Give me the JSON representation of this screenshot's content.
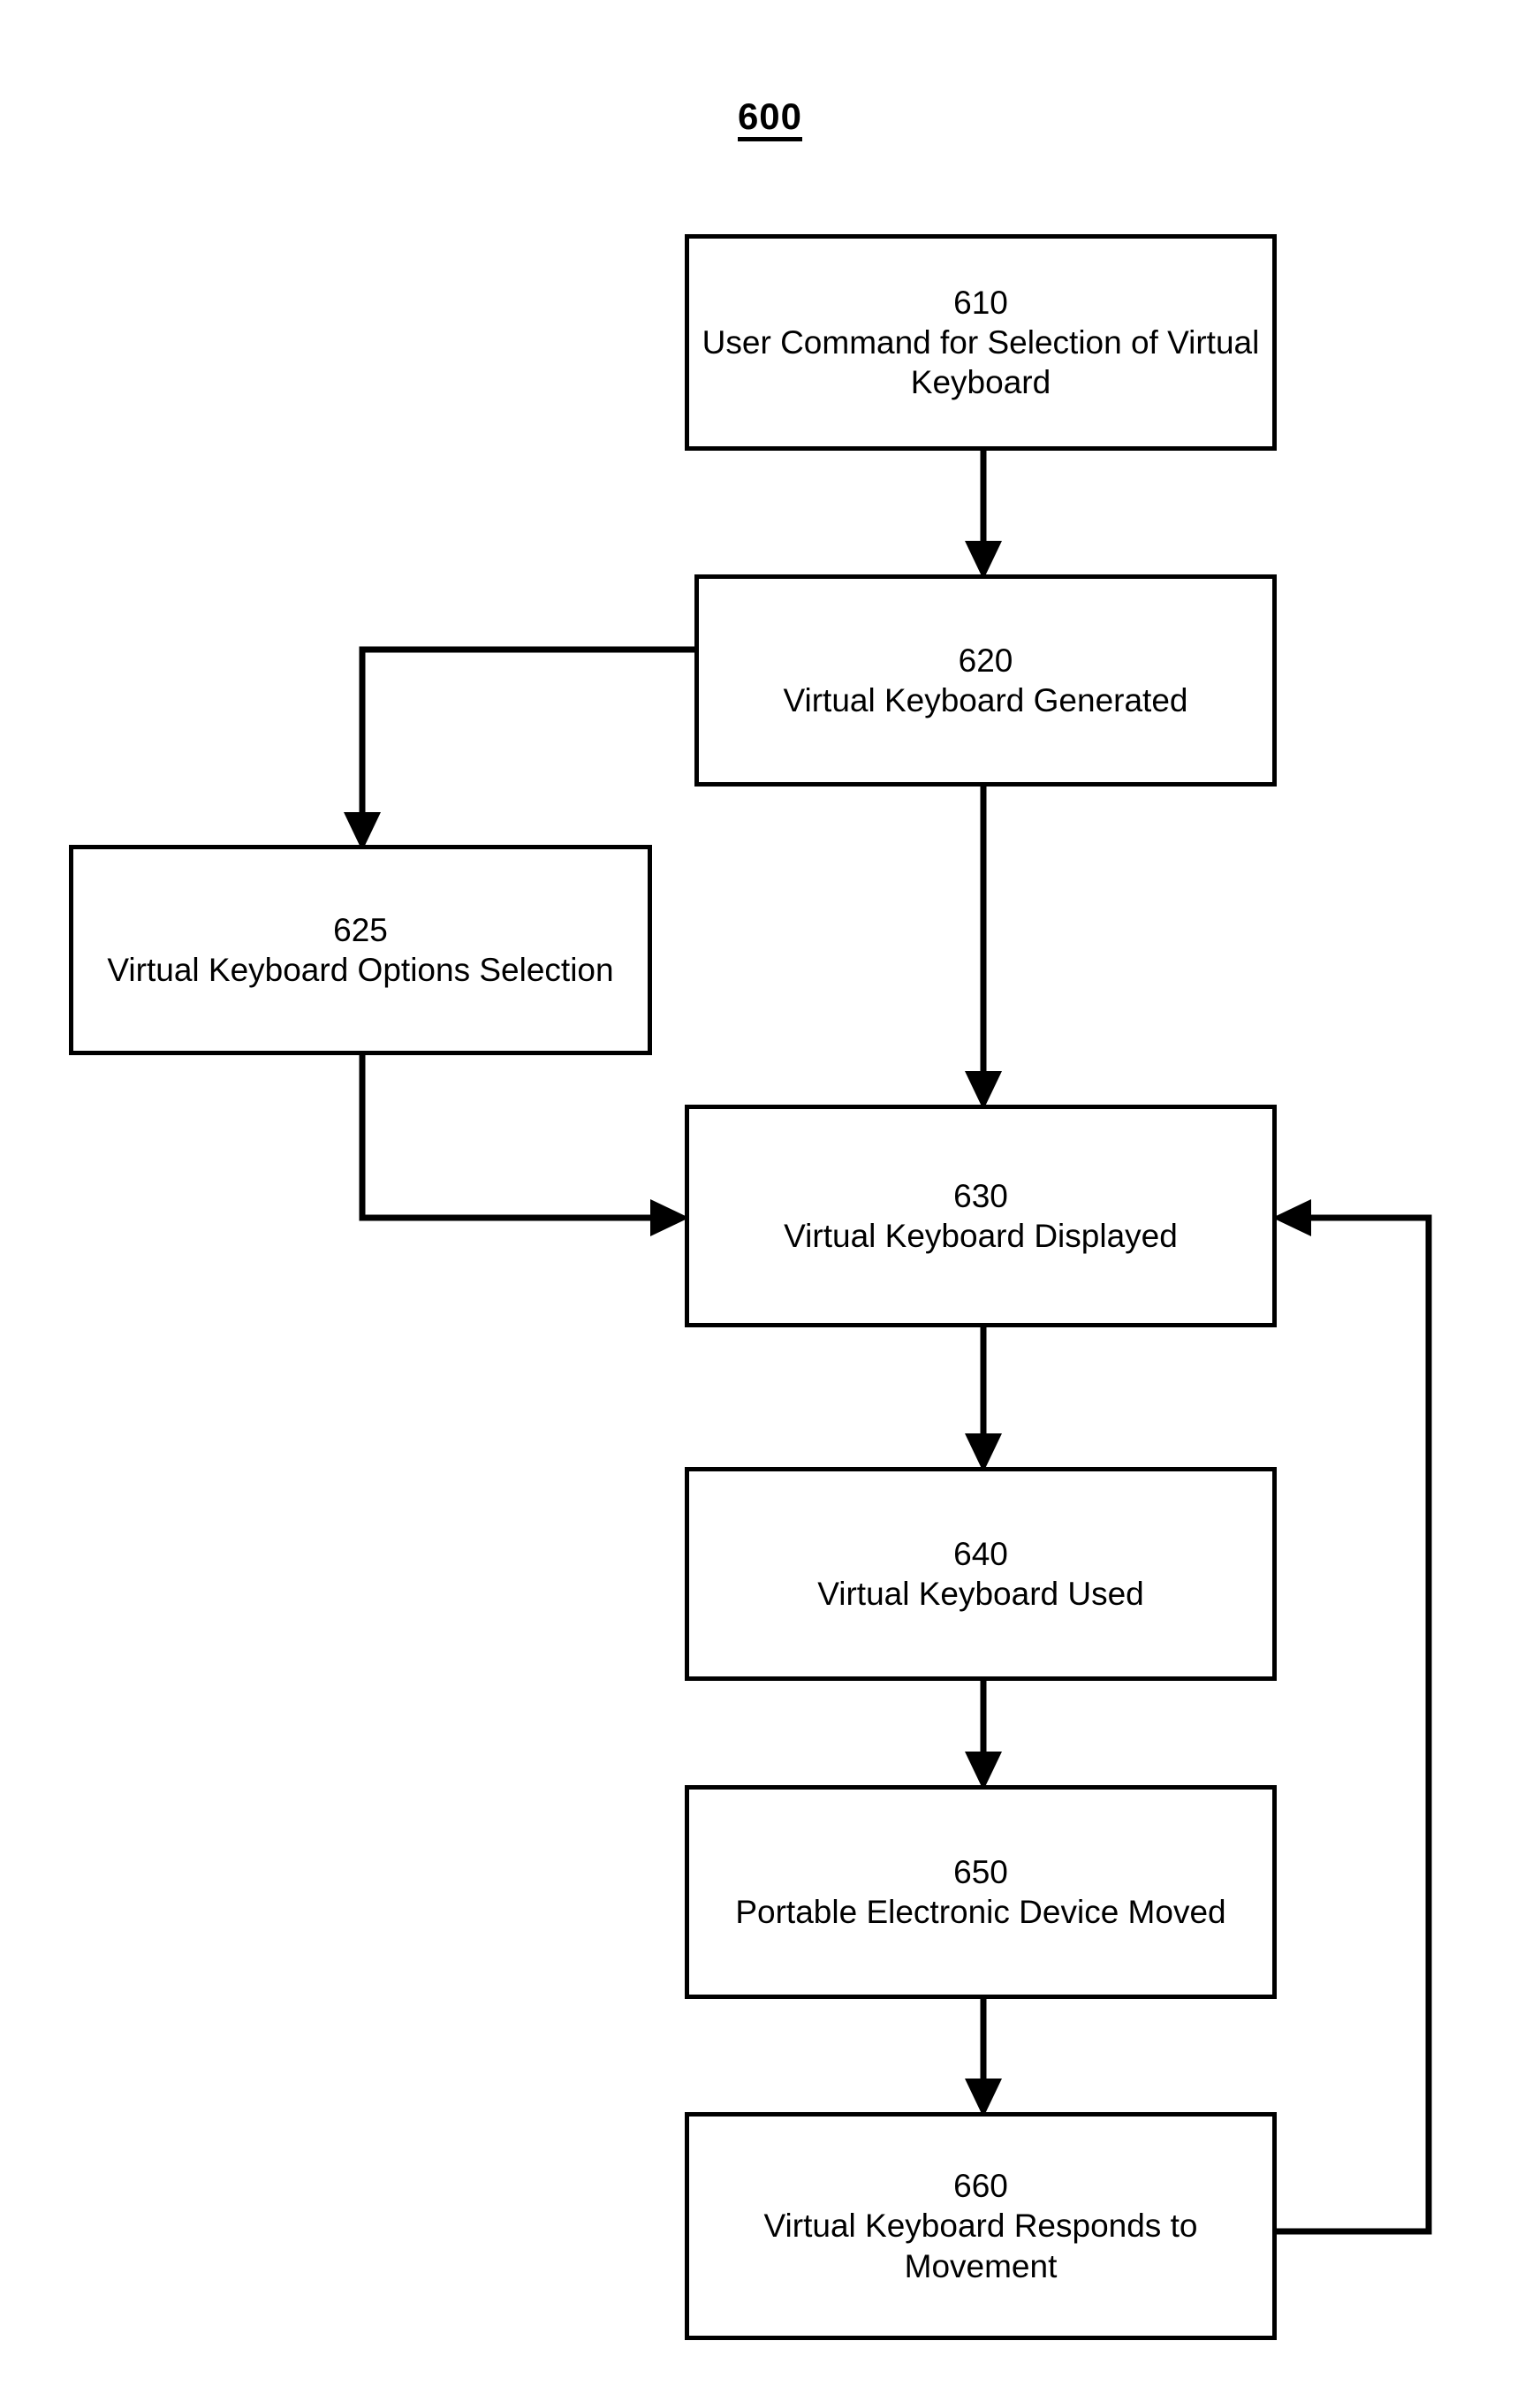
{
  "figure": {
    "number": "600",
    "type": "flowchart",
    "title_underlined": true
  },
  "nodes": [
    {
      "id": "610",
      "ref": "610",
      "label": "User Command for Selection of Virtual Keyboard",
      "shape": "rectangle"
    },
    {
      "id": "620",
      "ref": "620",
      "label": "Virtual Keyboard Generated",
      "shape": "rectangle"
    },
    {
      "id": "625",
      "ref": "625",
      "label": "Virtual Keyboard Options Selection",
      "shape": "rectangle"
    },
    {
      "id": "630",
      "ref": "630",
      "label": "Virtual Keyboard Displayed",
      "shape": "rectangle"
    },
    {
      "id": "640",
      "ref": "640",
      "label": "Virtual Keyboard Used",
      "shape": "rectangle"
    },
    {
      "id": "650",
      "ref": "650",
      "label": "Portable Electronic Device Moved",
      "shape": "rectangle"
    },
    {
      "id": "660",
      "ref": "660",
      "label": "Virtual Keyboard Responds to Movement",
      "shape": "rectangle"
    }
  ],
  "edges": [
    {
      "from": "610",
      "to": "620",
      "style": "straight-down",
      "arrow": true
    },
    {
      "from": "620",
      "to": "625",
      "style": "left-then-down",
      "arrow": true
    },
    {
      "from": "620",
      "to": "630",
      "style": "straight-down",
      "arrow": true
    },
    {
      "from": "625",
      "to": "630",
      "style": "down-then-right",
      "arrow": true
    },
    {
      "from": "630",
      "to": "640",
      "style": "straight-down",
      "arrow": true
    },
    {
      "from": "640",
      "to": "650",
      "style": "straight-down",
      "arrow": true
    },
    {
      "from": "650",
      "to": "660",
      "style": "straight-down",
      "arrow": true
    },
    {
      "from": "660",
      "to": "630",
      "style": "right-then-up-feedback",
      "arrow": true
    }
  ],
  "colors": {
    "stroke": "#000000",
    "background": "#ffffff",
    "text": "#000000"
  }
}
